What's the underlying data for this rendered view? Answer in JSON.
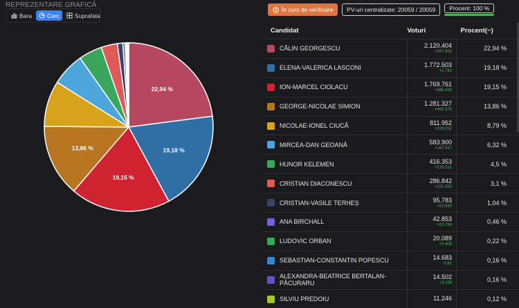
{
  "section_title": "REPREZENTARE GRAFICĂ",
  "view_toggle": {
    "bar_label": "Bara",
    "pie_label": "Cerc",
    "area_label": "Suprafata",
    "active": "Cerc"
  },
  "toolbar": {
    "status_label": "În curs de verificare",
    "pv_label": "PV-uri centralizate: 20059 / 20059",
    "percent_label": "Procent: 100 %",
    "percent_value": 100
  },
  "table": {
    "headers": {
      "candidate": "Candidat",
      "votes": "Voturi",
      "percent": "Procent(~)"
    }
  },
  "chart_data": {
    "type": "pie",
    "slice_labels": [
      "22,94 %",
      "19,18 %",
      "19,15 %",
      "13,86 %"
    ],
    "series": [
      {
        "name": "CĂLIN GEORGESCU",
        "votes": "2.120.404",
        "delta": "+347.901",
        "percent_label": "22,94 %",
        "value": 22.94,
        "color": "#b5475f"
      },
      {
        "name": "ELENA-VALERICA LASCONI",
        "votes": "1.772.503",
        "delta": "+2.742",
        "percent_label": "19,18 %",
        "value": 19.18,
        "color": "#2f6fa6"
      },
      {
        "name": "ION-MARCEL CIOLACU",
        "votes": "1.769.761",
        "delta": "+488.434",
        "percent_label": "19,15 %",
        "value": 19.15,
        "color": "#cf2331"
      },
      {
        "name": "GEORGE-NICOLAE SIMION",
        "votes": "1.281.327",
        "delta": "+469.375",
        "percent_label": "13,86 %",
        "value": 13.86,
        "color": "#b7761f"
      },
      {
        "name": "NICOLAE-IONEL CIUCĂ",
        "votes": "811.952",
        "delta": "+228.052",
        "percent_label": "8,79 %",
        "value": 8.79,
        "color": "#d8a21b"
      },
      {
        "name": "MIRCEA-DAN GEOANĂ",
        "votes": "583.900",
        "delta": "+167.547",
        "percent_label": "6,32 %",
        "value": 6.32,
        "color": "#4da6db"
      },
      {
        "name": "HUNOR KELEMEN",
        "votes": "416.353",
        "delta": "+129.511",
        "percent_label": "4,5 %",
        "value": 4.5,
        "color": "#3aa55d"
      },
      {
        "name": "CRISTIAN DIACONESCU",
        "votes": "286.842",
        "delta": "+191.059",
        "percent_label": "3,1 %",
        "value": 3.1,
        "color": "#dd5a56"
      },
      {
        "name": "CRISTIAN-VASILE TERHEȘ",
        "votes": "95.783",
        "delta": "+52.930",
        "percent_label": "1,04 %",
        "value": 1.04,
        "color": "#3a4466"
      },
      {
        "name": "ANA BIRCHALL",
        "votes": "42.853",
        "delta": "+22.764",
        "percent_label": "0,46 %",
        "value": 0.46,
        "color": "#7b5fd6"
      },
      {
        "name": "LUDOVIC ORBAN",
        "votes": "20.089",
        "delta": "+5.406",
        "percent_label": "0,22 %",
        "value": 0.22,
        "color": "#3aa55d"
      },
      {
        "name": "SEBASTIAN-CONSTANTIN POPESCU",
        "votes": "14.683",
        "delta": "+181",
        "percent_label": "0,16 %",
        "value": 0.16,
        "color": "#3a87c8"
      },
      {
        "name": "ALEXANDRA-BEATRICE BERTALAN-PĂCURARU",
        "votes": "14.502",
        "delta": "+3.256",
        "percent_label": "0,16 %",
        "value": 0.16,
        "color": "#6a4fc0"
      },
      {
        "name": "SILVIU PREDOIU",
        "votes": "11.246",
        "delta": "",
        "percent_label": "0,12 %",
        "value": 0.12,
        "color": "#a7c62a"
      }
    ]
  }
}
